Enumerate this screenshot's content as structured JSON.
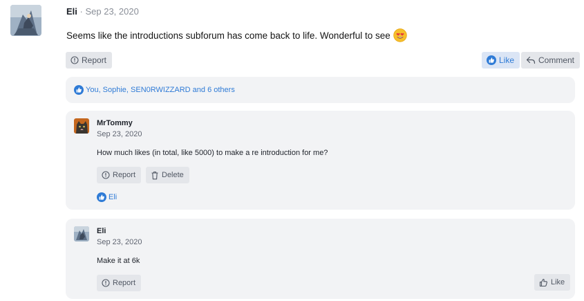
{
  "post": {
    "author": "Eli",
    "separator": " · ",
    "date": "Sep 23, 2020",
    "body": "Seems like the introductions subforum has come back to life. Wonderful to see",
    "emoji": "smiling-face-with-heart-eyes-icon",
    "actions": {
      "report": "Report",
      "like": "Like",
      "comment": "Comment"
    },
    "reactions": "You, Sophie, SEN0RWIZZARD and 6 others"
  },
  "replies": [
    {
      "author": "MrTommy",
      "date": "Sep 23, 2020",
      "text": "How much likes (in total, like 5000) to make a re introduction for me?",
      "report": "Report",
      "delete": "Delete",
      "liked_by": "Eli"
    },
    {
      "author": "Eli",
      "date": "Sep 23, 2020",
      "text": "Make it at 6k",
      "report": "Report",
      "like": "Like"
    }
  ],
  "colors": {
    "accent": "#2f7bd6",
    "button_bg": "#e4e6ea",
    "card_bg": "#f2f3f5"
  }
}
